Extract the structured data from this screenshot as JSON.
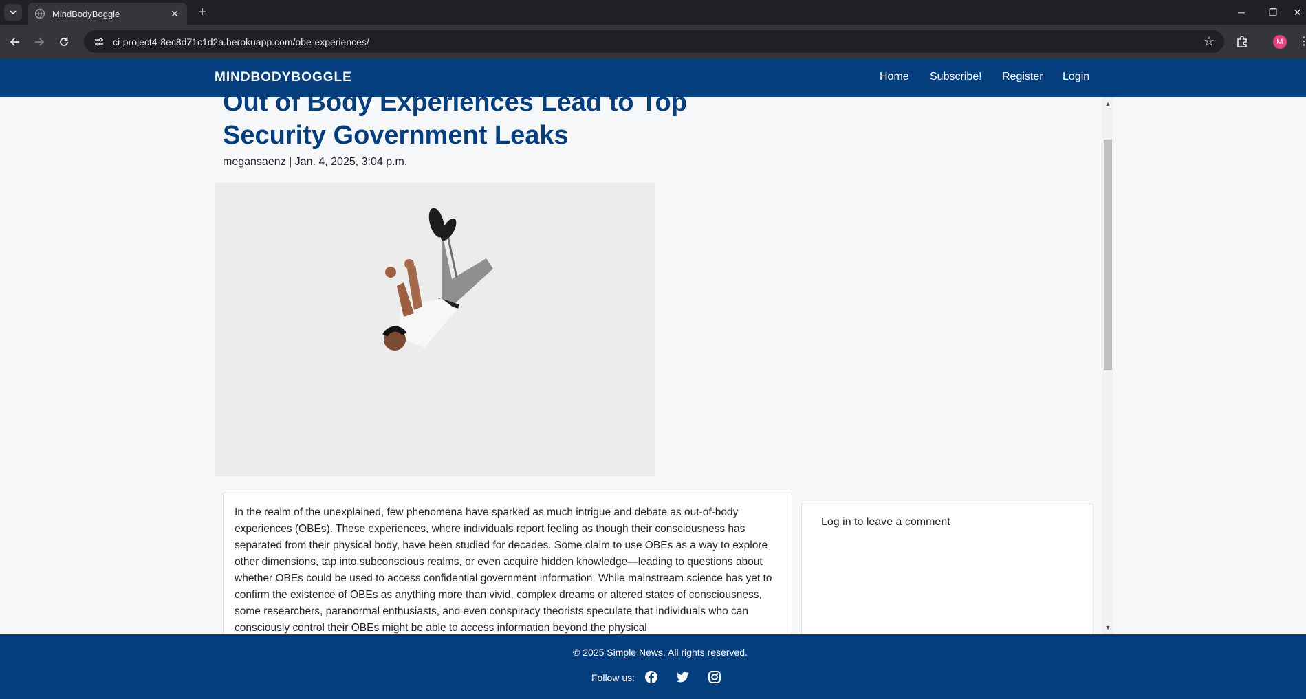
{
  "browser": {
    "tab_title": "MindBodyBoggle",
    "url": "ci-project4-8ec8d71c1d2a.herokuapp.com/obe-experiences/",
    "profile_initial": "M"
  },
  "site": {
    "brand": "MINDBODYBOGGLE",
    "nav": {
      "home": "Home",
      "subscribe": "Subscribe!",
      "register": "Register",
      "login": "Login"
    }
  },
  "post": {
    "title": "Out of Body Experiences Lead to Top Security Government Leaks",
    "byline": "megansaenz | Jan. 4, 2025, 3:04 p.m.",
    "body": "In the realm of the unexplained, few phenomena have sparked as much intrigue and debate as out-of-body experiences (OBEs). These experiences, where individuals report feeling as though their consciousness has separated from their physical body, have been studied for decades. Some claim to use OBEs as a way to explore other dimensions, tap into subconscious realms, or even acquire hidden knowledge—leading to questions about whether OBEs could be used to access confidential government information. While mainstream science has yet to confirm the existence of OBEs as anything more than vivid, complex dreams or altered states of consciousness, some researchers, paranormal enthusiasts, and even conspiracy theorists speculate that individuals who can consciously control their OBEs might be able to access information beyond the physical"
  },
  "comments": {
    "login_link": "Log in",
    "login_suffix": " to leave a comment"
  },
  "footer": {
    "copyright": "© 2025 Simple News. All rights reserved.",
    "follow_label": "Follow us:"
  },
  "colors": {
    "brand_blue": "#043e7d",
    "chrome_dark": "#202124"
  }
}
